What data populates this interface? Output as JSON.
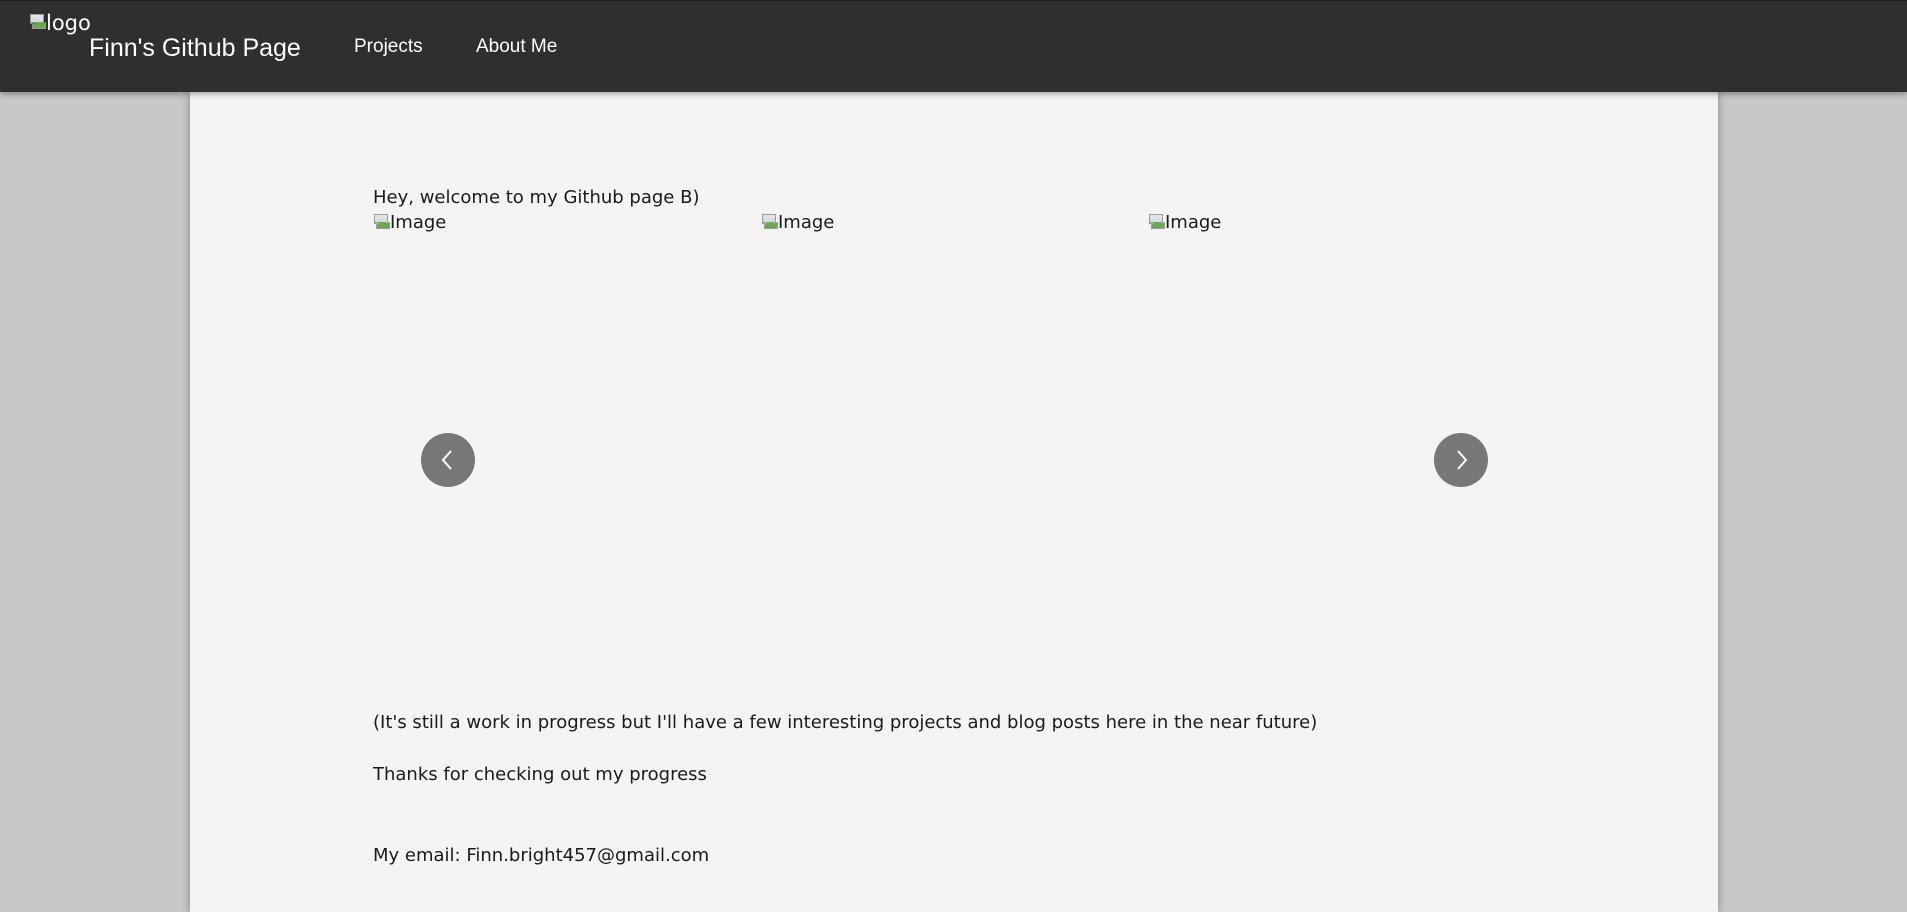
{
  "header": {
    "logo_alt": "logo",
    "site_title": "Finn's Github Page",
    "nav": {
      "projects": "Projects",
      "about": "About Me"
    }
  },
  "main": {
    "welcome": "Hey, welcome to my Github page B)",
    "carousel": {
      "images": [
        {
          "alt": "Image"
        },
        {
          "alt": "Image"
        },
        {
          "alt": "Image"
        }
      ],
      "prev_icon": "chevron-left-icon",
      "next_icon": "chevron-right-icon"
    },
    "wip_note": "(It's still a work in progress but I'll have a few interesting projects and blog posts here in the near future)",
    "thanks": "Thanks for checking out my progress",
    "email": "My email: Finn.bright457@gmail.com"
  },
  "colors": {
    "navbar_bg": "#2f2f2f",
    "page_bg": "#f4f4f4",
    "outer_bg": "#c8c8c8",
    "carousel_button": "#777777"
  }
}
